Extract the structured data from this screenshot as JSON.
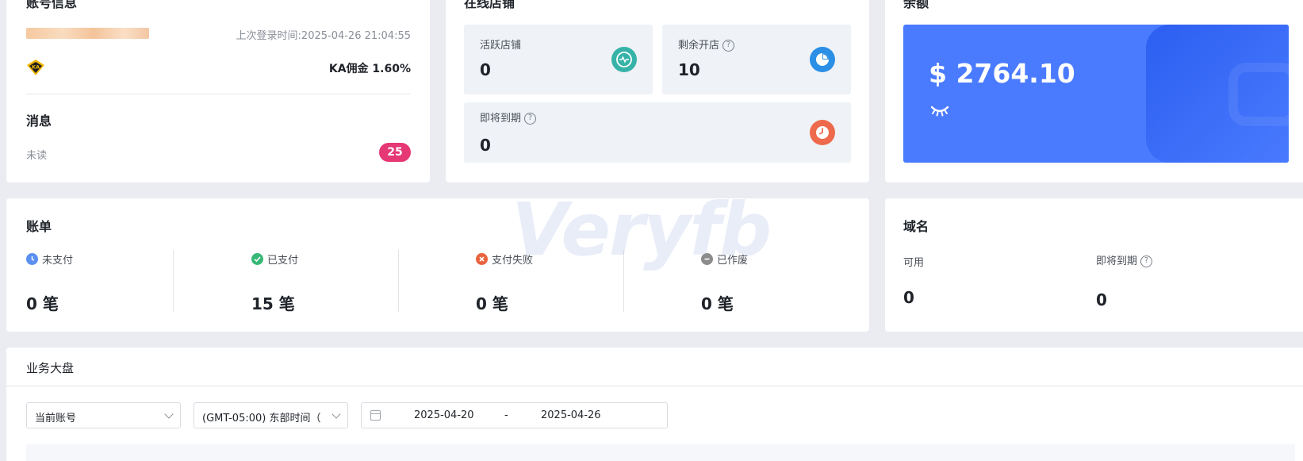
{
  "account": {
    "title": "账号信息",
    "last_login": "上次登录时间:2025-04-26 21:04:55",
    "ka_badge": "KA",
    "commission": "KA佣金 1.60%",
    "messages_title": "消息",
    "unread_label": "未读",
    "unread_count": "25"
  },
  "shops": {
    "title": "在线店铺",
    "active_label": "活跃店铺",
    "active_value": "0",
    "remaining_label": "剩余开店",
    "remaining_value": "10",
    "expiring_label": "即将到期",
    "expiring_value": "0"
  },
  "balance": {
    "title": "余额",
    "amount": "$ 2764.10",
    "accent": "#4a7bff"
  },
  "bills": {
    "title": "账单",
    "items": [
      {
        "label": "未支付",
        "value": "0 笔",
        "color": "#5b8ff0"
      },
      {
        "label": "已支付",
        "value": "15 笔",
        "color": "#37b876"
      },
      {
        "label": "支付失败",
        "value": "0 笔",
        "color": "#e8633e"
      },
      {
        "label": "已作废",
        "value": "0 笔",
        "color": "#8c8c8c"
      }
    ]
  },
  "watermark": "Veryfb",
  "domains": {
    "title": "域名",
    "available_label": "可用",
    "available_value": "0",
    "expiring_label": "即将到期",
    "expiring_value": "0"
  },
  "dashboard": {
    "title": "业务大盘",
    "account_select": "当前账号",
    "timezone_select": "(GMT-05:00) 东部时间（",
    "date_start": "2025-04-20",
    "date_sep": "-",
    "date_end": "2025-04-26"
  }
}
